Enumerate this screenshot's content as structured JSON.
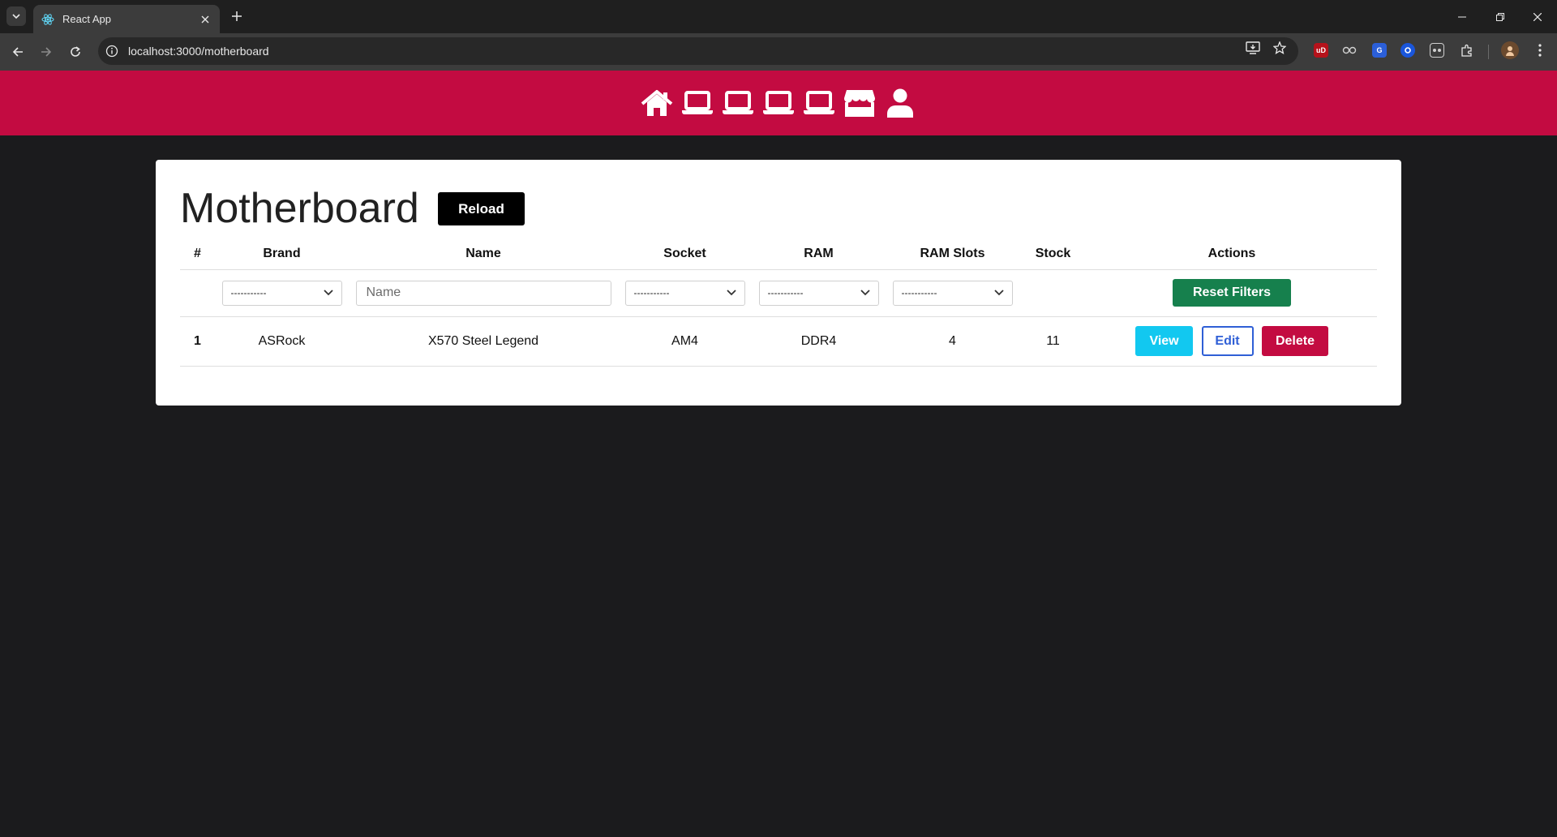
{
  "browser": {
    "tab_title": "React App",
    "url": "localhost:3000/motherboard"
  },
  "nav": {
    "icons": [
      "home-icon",
      "laptop-icon",
      "laptop-icon",
      "laptop-icon",
      "laptop-icon",
      "store-icon",
      "user-icon"
    ]
  },
  "page": {
    "title": "Motherboard",
    "reload_label": "Reload"
  },
  "table": {
    "headers": [
      "#",
      "Brand",
      "Name",
      "Socket",
      "RAM",
      "RAM Slots",
      "Stock",
      "Actions"
    ],
    "filters": {
      "brand": "-----------",
      "name_placeholder": "Name",
      "socket": "-----------",
      "ram": "-----------",
      "ram_slots": "-----------",
      "reset_label": "Reset Filters"
    },
    "rows": [
      {
        "index": "1",
        "brand": "ASRock",
        "name": "X570 Steel Legend",
        "socket": "AM4",
        "ram": "DDR4",
        "ram_slots": "4",
        "stock": "11"
      }
    ],
    "actions": {
      "view": "View",
      "edit": "Edit",
      "delete": "Delete"
    }
  },
  "colors": {
    "nav_bg": "#c30b41",
    "page_bg": "#1b1b1d",
    "reset_button": "#16804d",
    "view_button": "#12c8f0",
    "edit_border": "#2f5fd6",
    "delete_button": "#c30b41"
  }
}
